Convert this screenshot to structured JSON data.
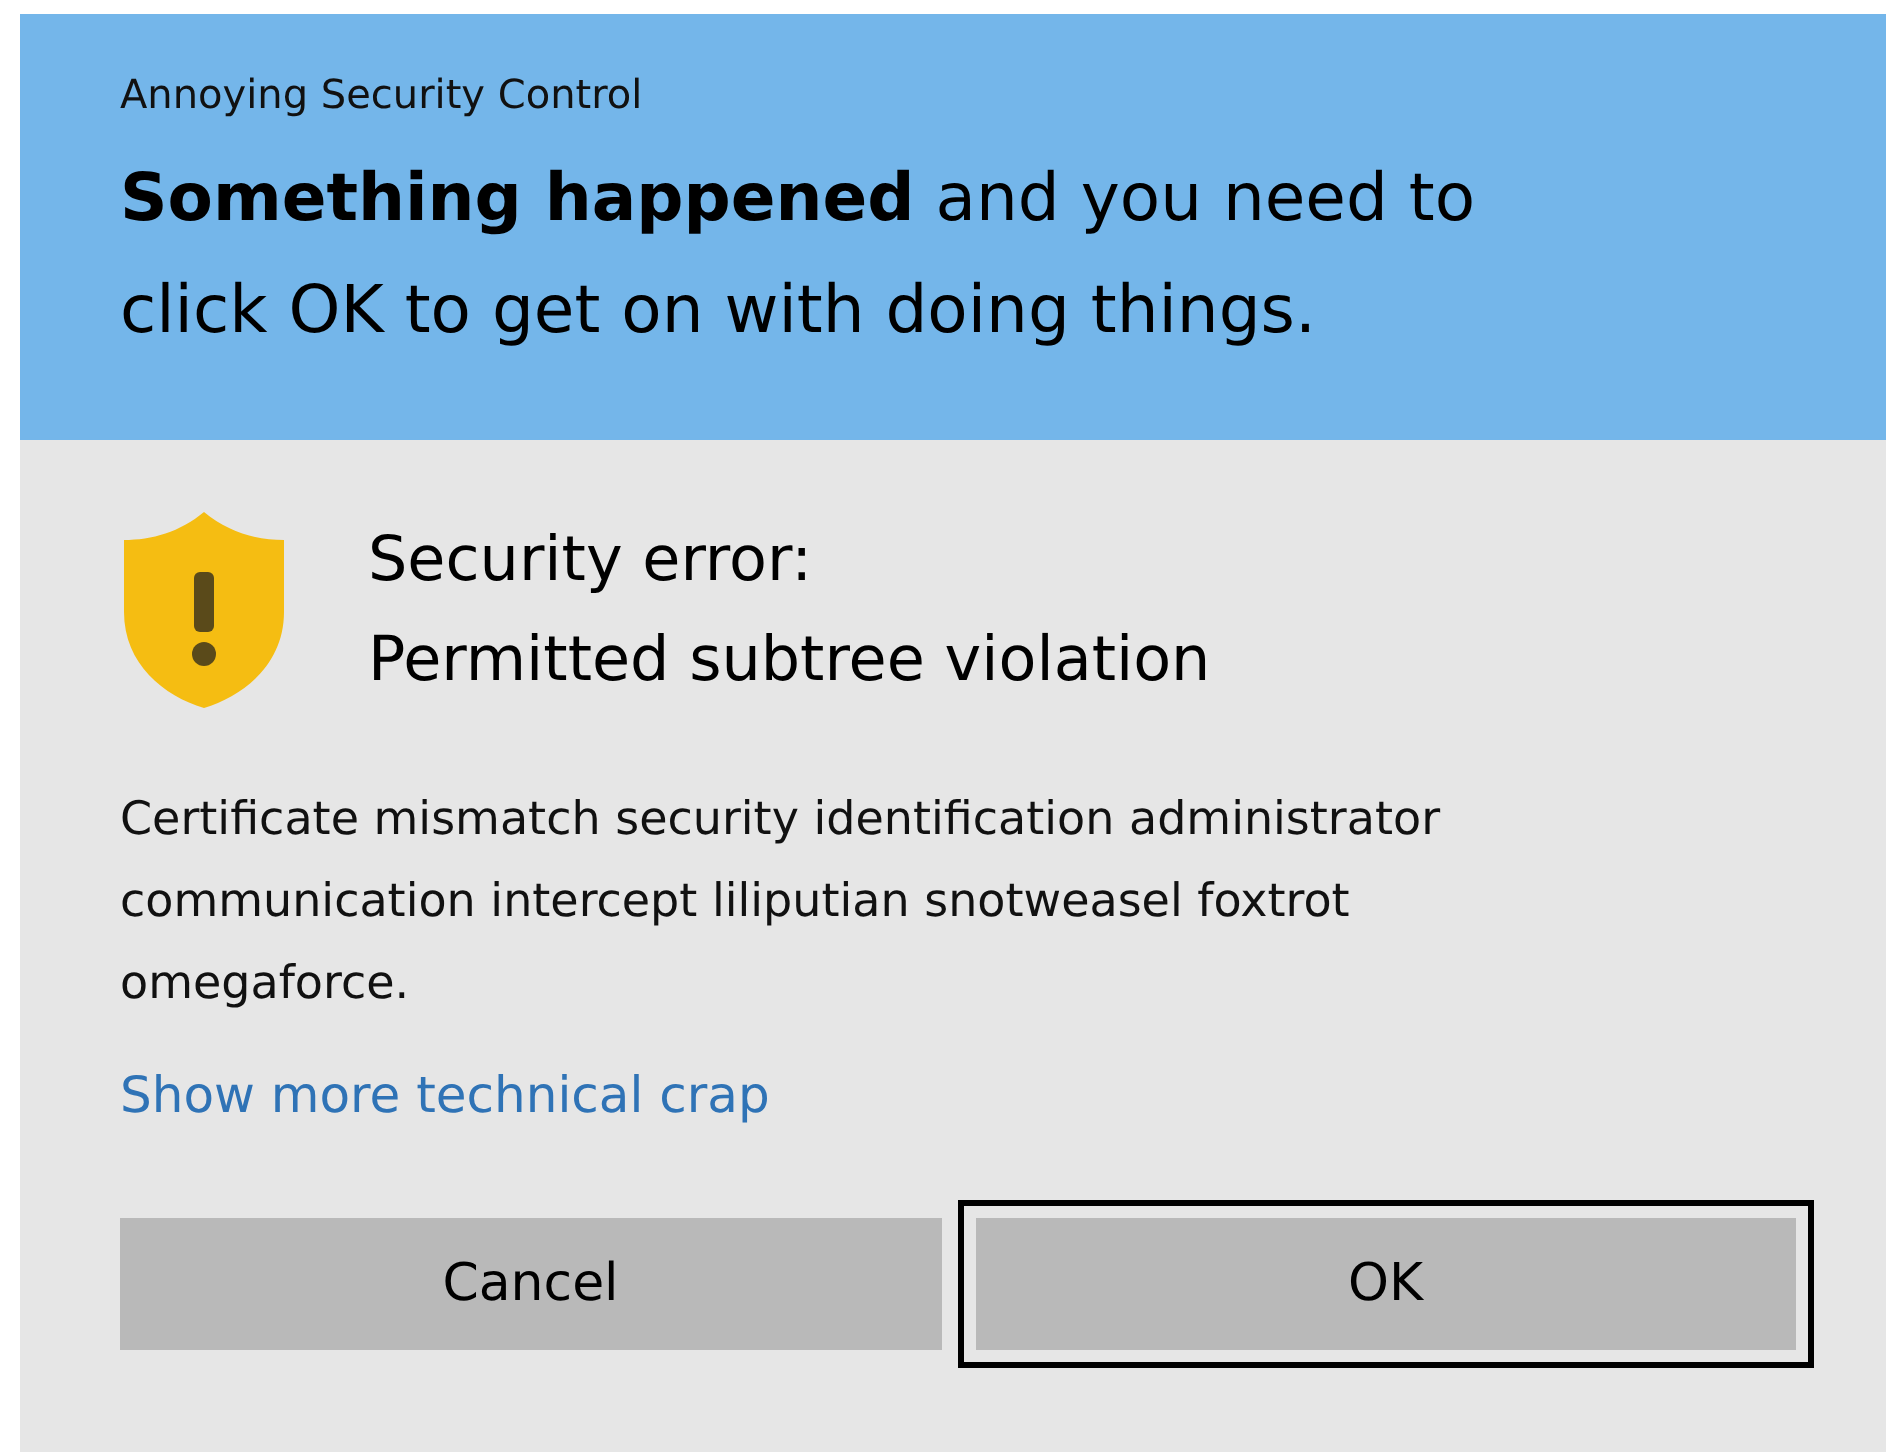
{
  "dialog": {
    "app_name": "Annoying Security Control",
    "headline": "**Something happened** and you need to click OK to get on with doing things.",
    "error_lines": [
      "Security error:",
      "Permitted subtree violation"
    ],
    "description": "Certificate mismatch security identification administrator communication intercept liliputian snotweasel foxtrot omegaforce.",
    "link": "Show more technical crap",
    "buttons": [
      {
        "label": "Cancel",
        "focused": false
      },
      {
        "label": "OK",
        "focused": true
      }
    ]
  }
}
